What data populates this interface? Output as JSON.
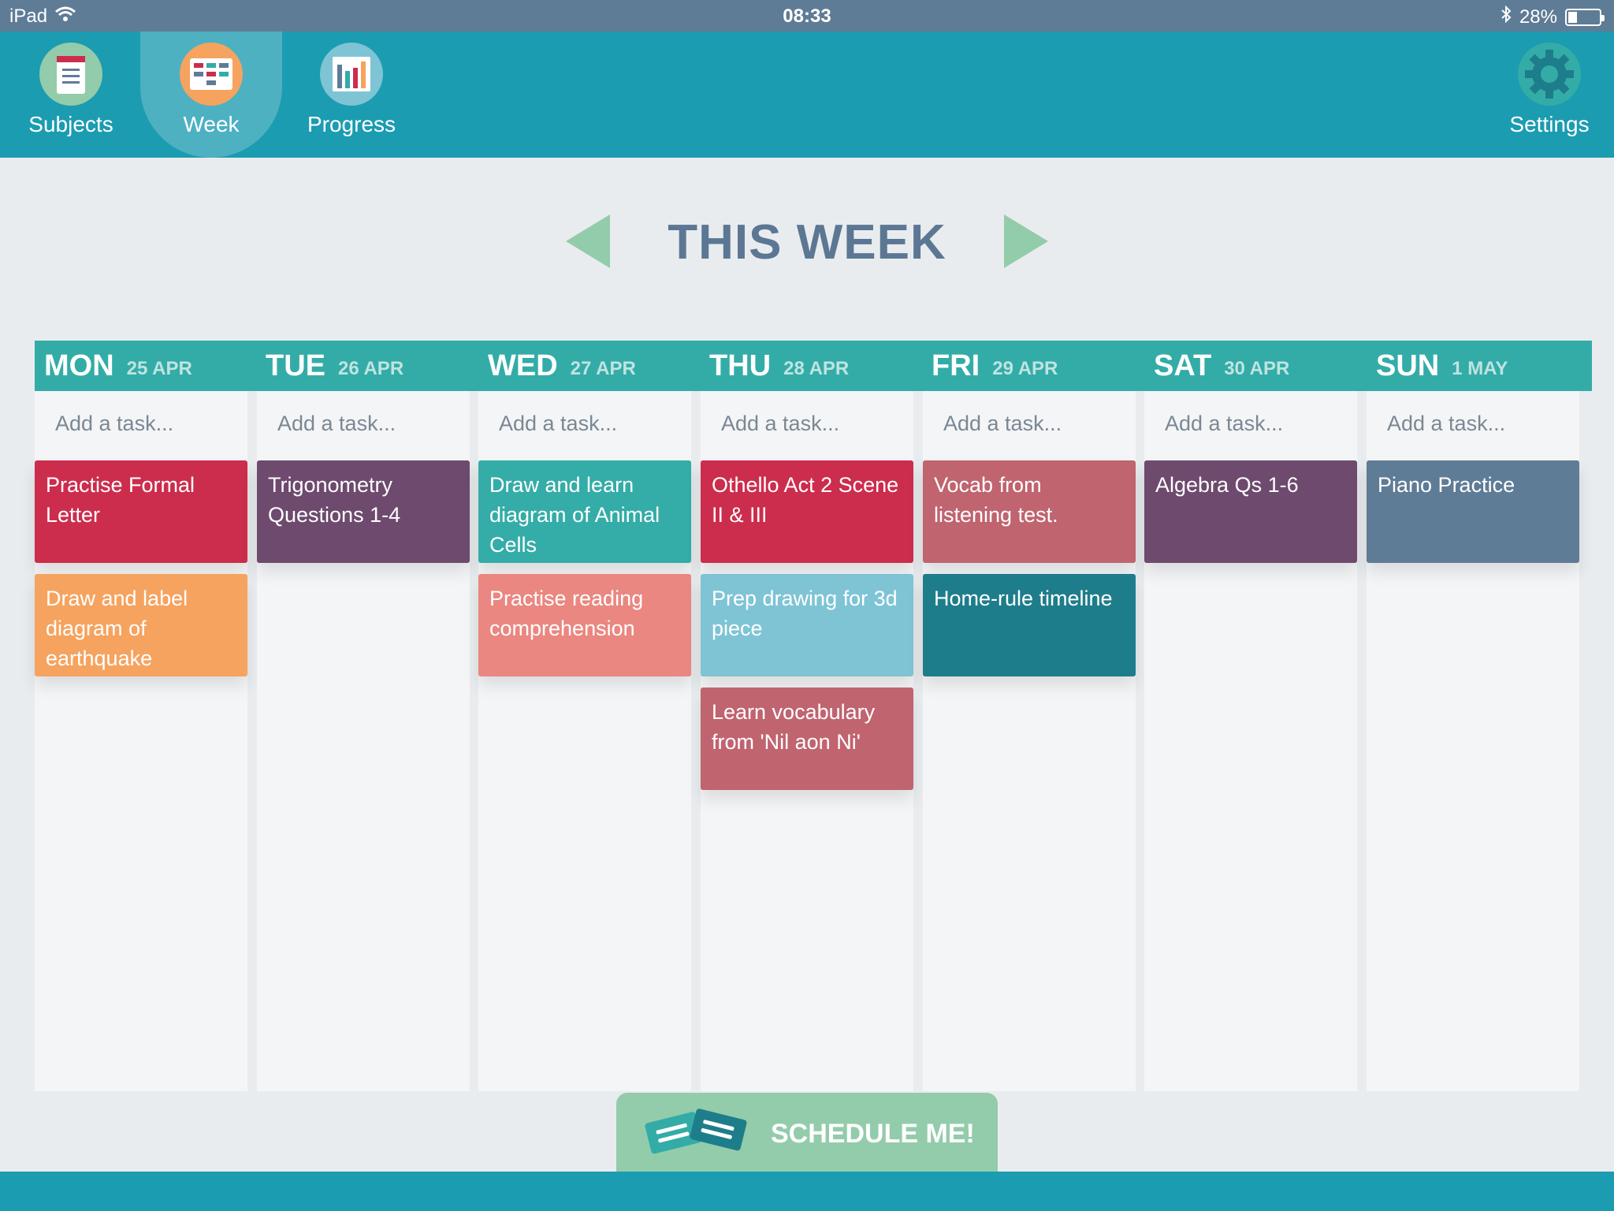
{
  "status": {
    "device": "iPad",
    "time": "08:33",
    "battery": "28%",
    "battery_level": 0.28
  },
  "nav": {
    "subjects": "Subjects",
    "week": "Week",
    "progress": "Progress",
    "settings": "Settings"
  },
  "header": {
    "title": "THIS WEEK"
  },
  "days": [
    {
      "name": "MON",
      "date": "25 APR",
      "add": "Add a task...",
      "tasks": [
        {
          "text": "Practise Formal Letter",
          "color": "#cc2d4d"
        },
        {
          "text": "Draw and label diagram of earthquake",
          "color": "#f5a35f"
        }
      ]
    },
    {
      "name": "TUE",
      "date": "26 APR",
      "add": "Add a task...",
      "tasks": [
        {
          "text": "Trigonometry Questions 1-4",
          "color": "#6e4a6e"
        }
      ]
    },
    {
      "name": "WED",
      "date": "27 APR",
      "add": "Add a task...",
      "tasks": [
        {
          "text": "Draw and learn diagram of Animal Cells",
          "color": "#34aca8"
        },
        {
          "text": "Practise reading comprehension",
          "color": "#ea8780"
        }
      ]
    },
    {
      "name": "THU",
      "date": "28 APR",
      "add": "Add a task...",
      "tasks": [
        {
          "text": "Othello Act 2 Scene II & III",
          "color": "#cc2d4d"
        },
        {
          "text": "Prep drawing for 3d piece",
          "color": "#7ec4d5"
        },
        {
          "text": "Learn vocabulary from 'Nil aon Ni'",
          "color": "#c06470"
        }
      ]
    },
    {
      "name": "FRI",
      "date": "29 APR",
      "add": "Add a task...",
      "tasks": [
        {
          "text": "Vocab from listening test.",
          "color": "#c06470"
        },
        {
          "text": "Home-rule timeline",
          "color": "#1e7d8b"
        }
      ]
    },
    {
      "name": "SAT",
      "date": "30 APR",
      "add": "Add a task...",
      "tasks": [
        {
          "text": "Algebra Qs 1-6",
          "color": "#6e4a6e"
        }
      ]
    },
    {
      "name": "SUN",
      "date": "1 MAY",
      "add": "Add a task...",
      "tasks": [
        {
          "text": "Piano Practice",
          "color": "#5f7c96"
        }
      ]
    }
  ],
  "schedule": {
    "label": "SCHEDULE ME!"
  }
}
